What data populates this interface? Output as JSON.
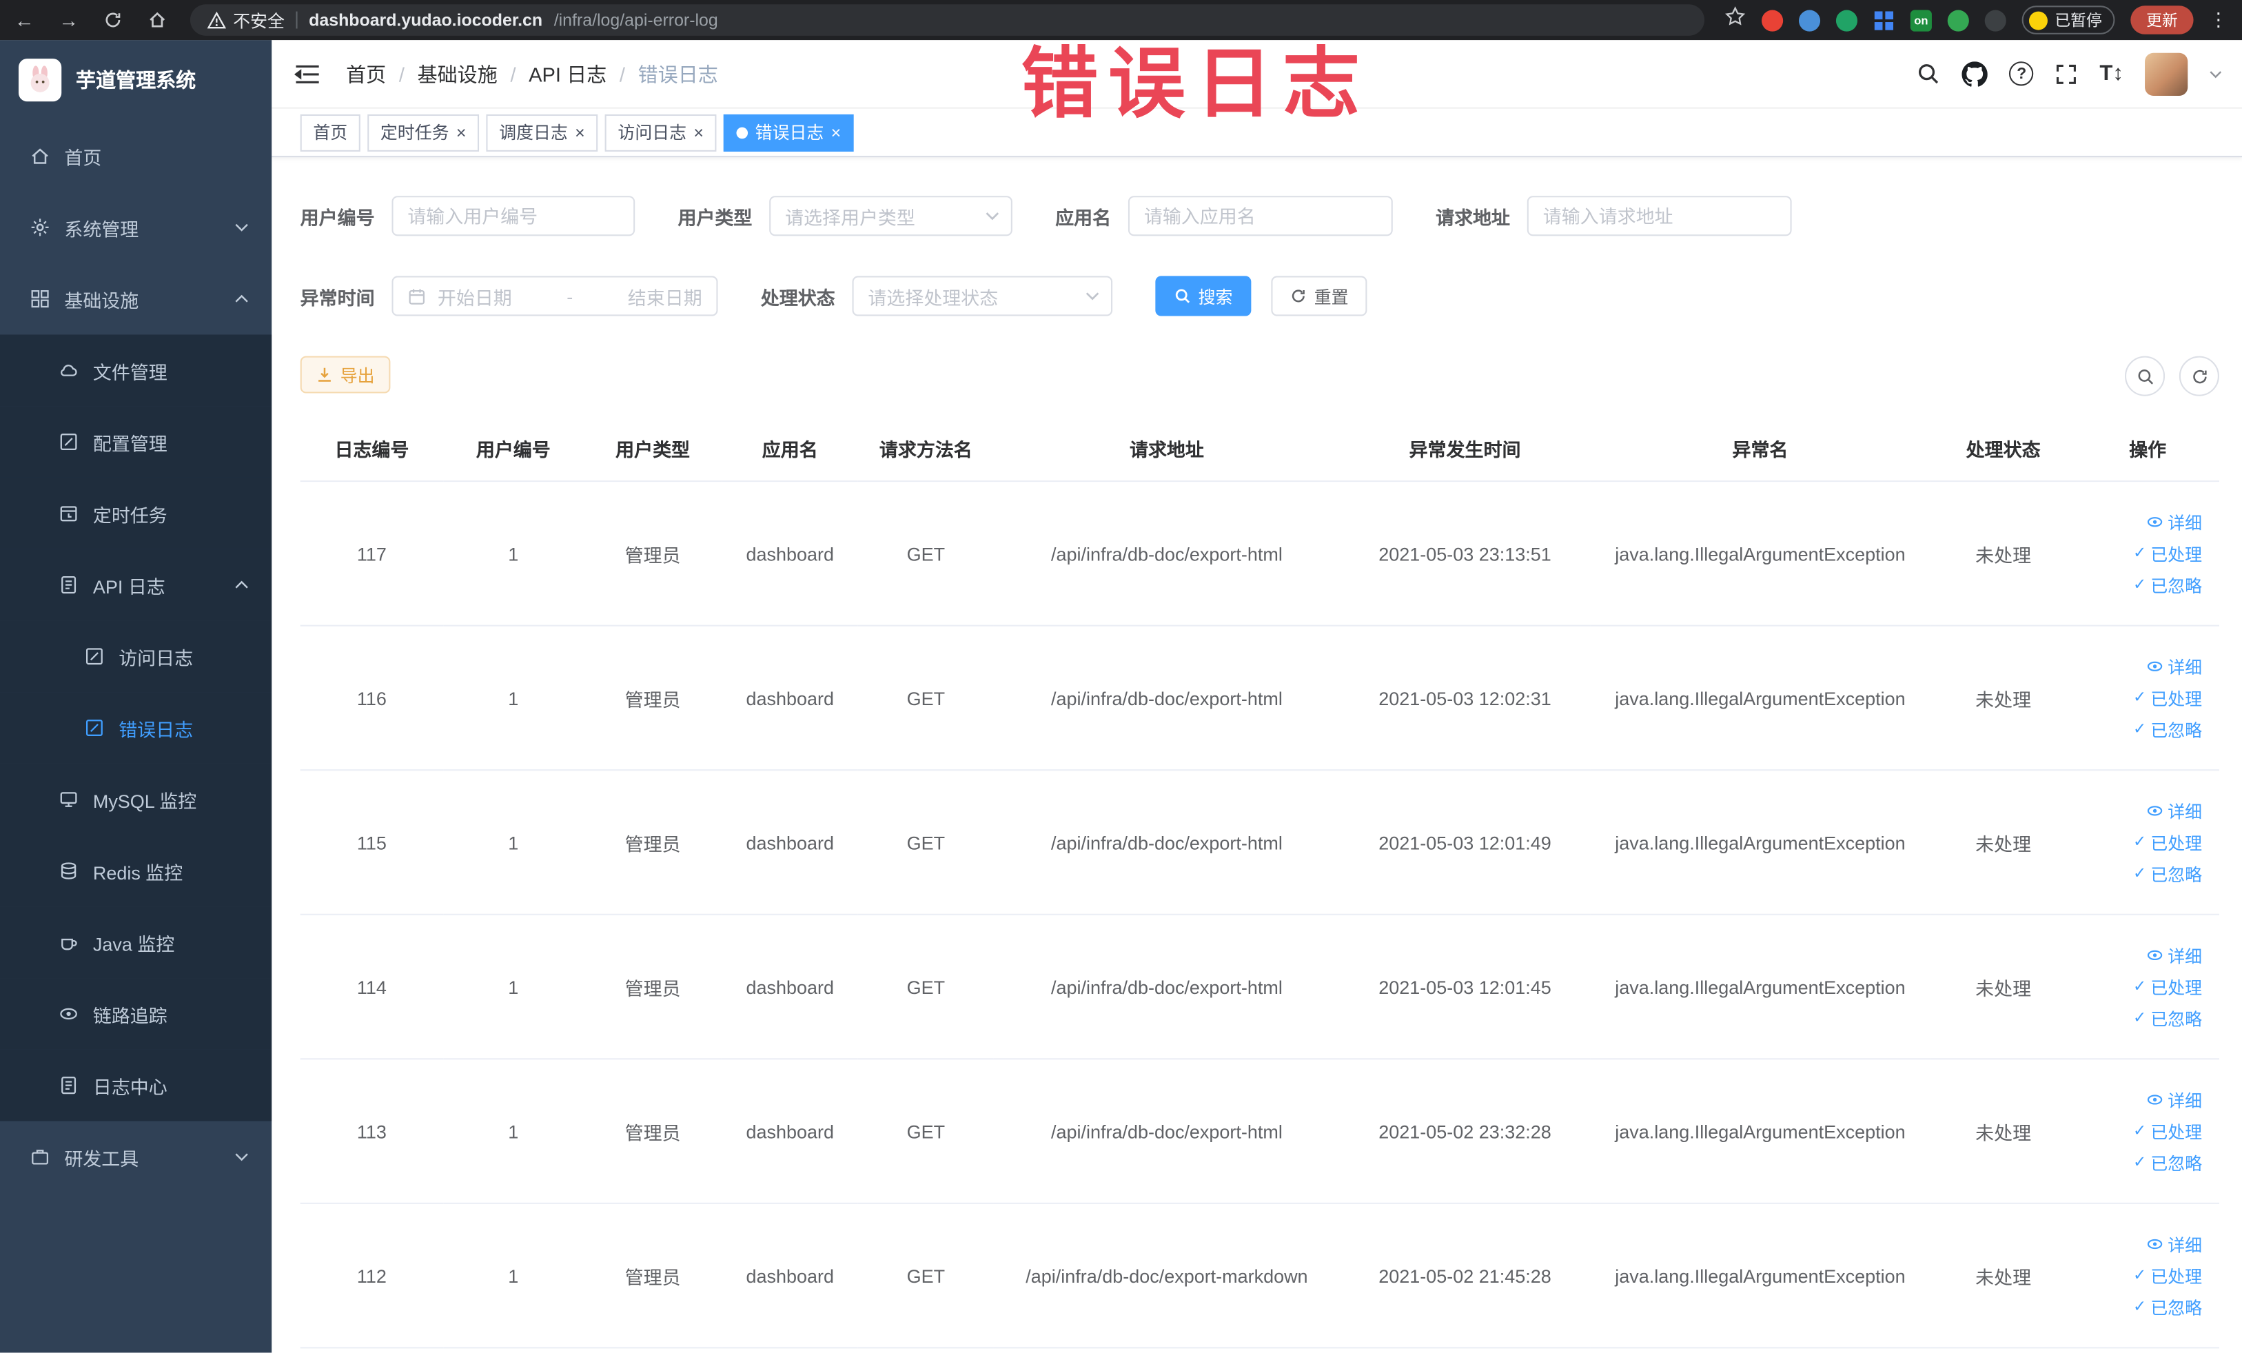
{
  "browser": {
    "security_label": "不安全",
    "url_domain": "dashboard.yudao.iocoder.cn",
    "url_path": "/infra/log/api-error-log",
    "extension_on_label": "on",
    "paused_badge": "已暂停",
    "update_button": "更新"
  },
  "watermark": "错误日志",
  "sidebar": {
    "logo_title": "芋道管理系统",
    "menu": {
      "home": "首页",
      "system": "系统管理",
      "infrastructure": "基础设施",
      "file": "文件管理",
      "config": "配置管理",
      "job": "定时任务",
      "api_log": "API 日志",
      "access_log": "访问日志",
      "error_log": "错误日志",
      "mysql": "MySQL 监控",
      "redis": "Redis 监控",
      "java": "Java 监控",
      "trace": "链路追踪",
      "log_center": "日志中心",
      "dev_tools": "研发工具"
    }
  },
  "header": {
    "breadcrumb": [
      "首页",
      "基础设施",
      "API 日志",
      "错误日志"
    ],
    "separator": "/"
  },
  "tabs": [
    {
      "label": "首页"
    },
    {
      "label": "定时任务"
    },
    {
      "label": "调度日志"
    },
    {
      "label": "访问日志"
    },
    {
      "label": "错误日志"
    }
  ],
  "ui": {
    "close_glyph": "×"
  },
  "filters": {
    "user_id": {
      "label": "用户编号",
      "placeholder": "请输入用户编号"
    },
    "user_type": {
      "label": "用户类型",
      "placeholder": "请选择用户类型"
    },
    "app_name": {
      "label": "应用名",
      "placeholder": "请输入应用名"
    },
    "request_url": {
      "label": "请求地址",
      "placeholder": "请输入请求地址"
    },
    "exception_time": {
      "label": "异常时间",
      "start_placeholder": "开始日期",
      "separator": "-",
      "end_placeholder": "结束日期"
    },
    "process_status": {
      "label": "处理状态",
      "placeholder": "请选择处理状态"
    },
    "search_button": "搜索",
    "reset_button": "重置"
  },
  "toolbar": {
    "export_button": "导出"
  },
  "table": {
    "columns": [
      "日志编号",
      "用户编号",
      "用户类型",
      "应用名",
      "请求方法名",
      "请求地址",
      "异常发生时间",
      "异常名",
      "处理状态",
      "操作"
    ],
    "actions": {
      "detail": "详细",
      "processed": "已处理",
      "ignored": "已忽略"
    },
    "rows": [
      {
        "id": "117",
        "user_id": "1",
        "user_type": "管理员",
        "app": "dashboard",
        "method": "GET",
        "url": "/api/infra/db-doc/export-html",
        "time": "2021-05-03 23:13:51",
        "exception": "java.lang.IllegalArgumentException",
        "status": "未处理"
      },
      {
        "id": "116",
        "user_id": "1",
        "user_type": "管理员",
        "app": "dashboard",
        "method": "GET",
        "url": "/api/infra/db-doc/export-html",
        "time": "2021-05-03 12:02:31",
        "exception": "java.lang.IllegalArgumentException",
        "status": "未处理"
      },
      {
        "id": "115",
        "user_id": "1",
        "user_type": "管理员",
        "app": "dashboard",
        "method": "GET",
        "url": "/api/infra/db-doc/export-html",
        "time": "2021-05-03 12:01:49",
        "exception": "java.lang.IllegalArgumentException",
        "status": "未处理"
      },
      {
        "id": "114",
        "user_id": "1",
        "user_type": "管理员",
        "app": "dashboard",
        "method": "GET",
        "url": "/api/infra/db-doc/export-html",
        "time": "2021-05-03 12:01:45",
        "exception": "java.lang.IllegalArgumentException",
        "status": "未处理"
      },
      {
        "id": "113",
        "user_id": "1",
        "user_type": "管理员",
        "app": "dashboard",
        "method": "GET",
        "url": "/api/infra/db-doc/export-html",
        "time": "2021-05-02 23:32:28",
        "exception": "java.lang.IllegalArgumentException",
        "status": "未处理"
      },
      {
        "id": "112",
        "user_id": "1",
        "user_type": "管理员",
        "app": "dashboard",
        "method": "GET",
        "url": "/api/infra/db-doc/export-markdown",
        "time": "2021-05-02 21:45:28",
        "exception": "java.lang.IllegalArgumentException",
        "status": "未处理"
      }
    ]
  },
  "theme": {
    "accent": "#409eff",
    "watermark_red": "#e93d4d",
    "warning": "#e6a23c",
    "sidebar_bg": "#304156",
    "submenu_bg": "#1f2d3d",
    "chrome_bg": "#202124"
  }
}
